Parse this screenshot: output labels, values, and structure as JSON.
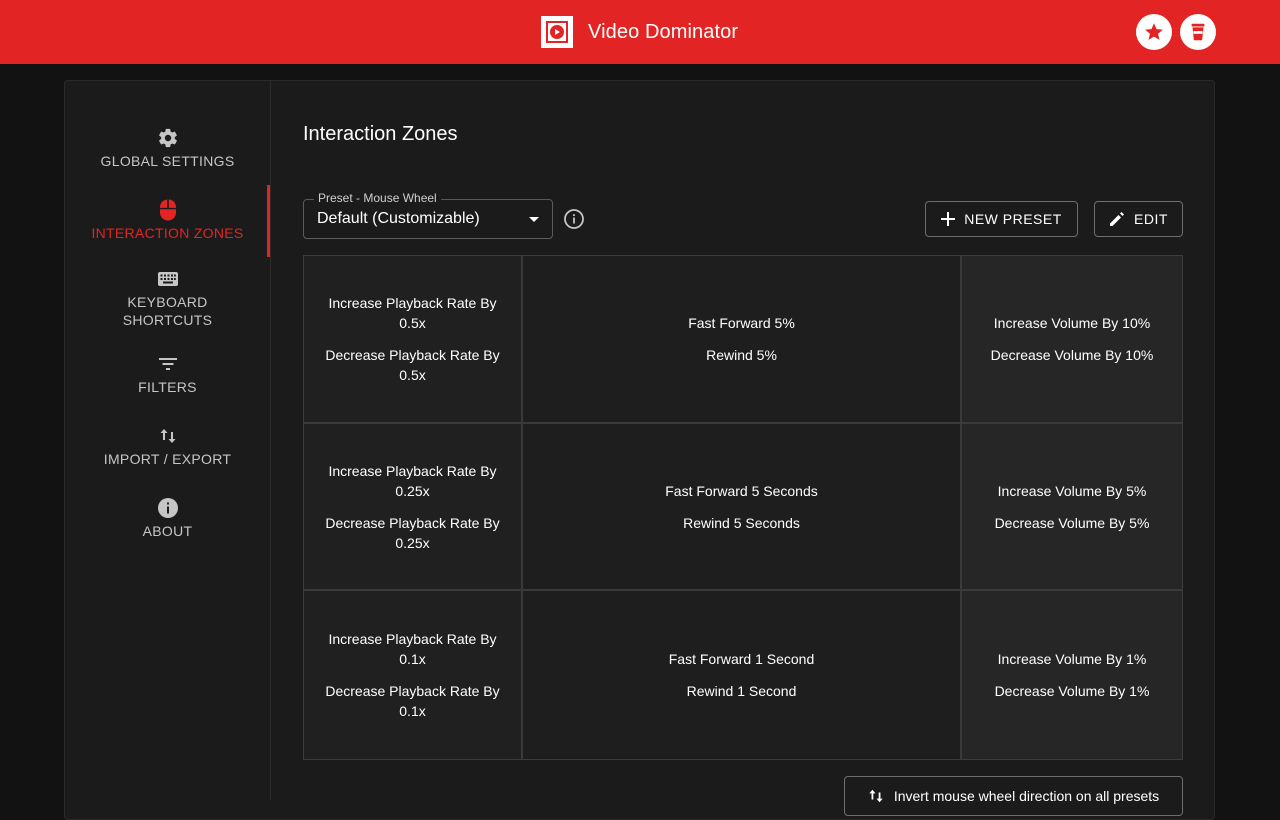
{
  "header": {
    "title": "Video Dominator",
    "star_icon": "star-icon",
    "coffee_icon": "coffee-cup-icon"
  },
  "colors": {
    "accent": "#e32424",
    "background": "#121212",
    "card": "#1b1b1b"
  },
  "sidebar": {
    "items": [
      {
        "label": "GLOBAL SETTINGS",
        "icon": "gear-icon",
        "active": false
      },
      {
        "label": "INTERACTION ZONES",
        "icon": "mouse-icon",
        "active": true
      },
      {
        "label": "KEYBOARD\nSHORTCUTS",
        "icon": "keyboard-icon",
        "active": false
      },
      {
        "label": "FILTERS",
        "icon": "filter-icon",
        "active": false
      },
      {
        "label": "IMPORT / EXPORT",
        "icon": "swap-vertical-icon",
        "active": false
      },
      {
        "label": "ABOUT",
        "icon": "info-icon",
        "active": false
      }
    ]
  },
  "main": {
    "title": "Interaction Zones",
    "preset_select": {
      "label": "Preset - Mouse Wheel",
      "value": "Default (Customizable)"
    },
    "new_preset_label": "NEW PRESET",
    "edit_label": "EDIT",
    "zones": [
      [
        {
          "up": "Increase Playback Rate By 0.5x",
          "down": "Decrease Playback Rate By 0.5x"
        },
        {
          "up": "Fast Forward 5%",
          "down": "Rewind 5%"
        },
        {
          "up": "Increase Volume By 10%",
          "down": "Decrease Volume By 10%"
        }
      ],
      [
        {
          "up": "Increase Playback Rate By 0.25x",
          "down": "Decrease Playback Rate By 0.25x"
        },
        {
          "up": "Fast Forward 5 Seconds",
          "down": "Rewind 5 Seconds"
        },
        {
          "up": "Increase Volume By 5%",
          "down": "Decrease Volume By 5%"
        }
      ],
      [
        {
          "up": "Increase Playback Rate By 0.1x",
          "down": "Decrease Playback Rate By 0.1x"
        },
        {
          "up": "Fast Forward 1 Second",
          "down": "Rewind 1 Second"
        },
        {
          "up": "Increase Volume By 1%",
          "down": "Decrease Volume By 1%"
        }
      ]
    ],
    "invert_label": "Invert mouse wheel direction on all presets"
  }
}
